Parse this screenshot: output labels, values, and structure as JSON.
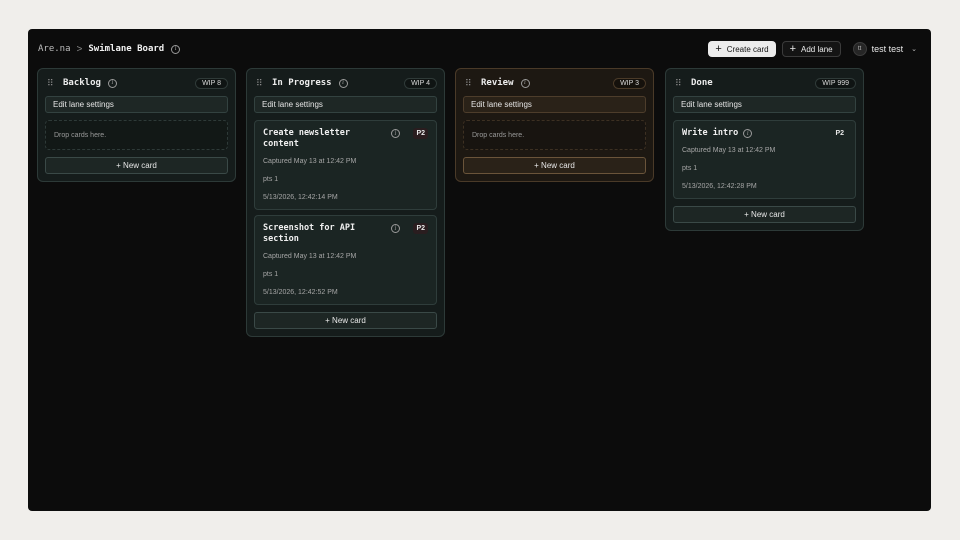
{
  "header": {
    "root": "Are.na",
    "separator": ">",
    "title": "Swimlane Board",
    "create_card": "Create card",
    "add_lane": "Add lane",
    "user_initials": "tt",
    "user_name": "test test"
  },
  "lanes": [
    {
      "title": "Backlog",
      "wip": "WIP 8",
      "settings": "Edit lane settings",
      "drop": "Drop cards here.",
      "new_card": "+ New card",
      "cards": []
    },
    {
      "title": "In Progress",
      "wip": "WIP 4",
      "settings": "Edit lane settings",
      "new_card": "+ New card",
      "cards": [
        {
          "title": "Create newsletter content",
          "priority": "P2",
          "captured": "Captured May 13 at 12:42 PM",
          "pts": "pts 1",
          "timestamp": "5/13/2026, 12:42:14 PM"
        },
        {
          "title": "Screenshot for API section",
          "priority": "P2",
          "captured": "Captured May 13 at 12:42 PM",
          "pts": "pts 1",
          "timestamp": "5/13/2026, 12:42:52 PM"
        }
      ]
    },
    {
      "title": "Review",
      "wip": "WIP 3",
      "settings": "Edit lane settings",
      "drop": "Drop cards here.",
      "new_card": "+ New card",
      "cards": []
    },
    {
      "title": "Done",
      "wip": "WIP 999",
      "settings": "Edit lane settings",
      "new_card": "+ New card",
      "cards": [
        {
          "title": "Write intro",
          "priority": "P2",
          "captured": "Captured May 13 at 12:42 PM",
          "pts": "pts 1",
          "timestamp": "5/13/2026, 12:42:28 PM"
        }
      ]
    }
  ],
  "colors": {
    "accent_green": "#151c1b",
    "accent_brown": "#1d1812"
  }
}
